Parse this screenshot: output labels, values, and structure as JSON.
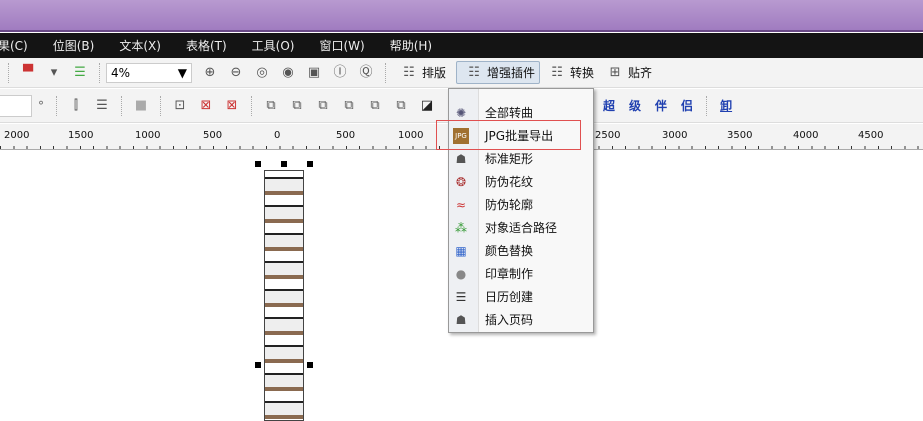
{
  "menubar": [
    "果(C)",
    "位图(B)",
    "文本(X)",
    "表格(T)",
    "工具(O)",
    "窗口(W)",
    "帮助(H)"
  ],
  "toolbar1": {
    "zoom_value": "4%",
    "buttons": [
      {
        "label": "排版",
        "icon": "layout-icon"
      },
      {
        "label": "增强插件",
        "icon": "plugin-icon",
        "active": true
      },
      {
        "label": "转换",
        "icon": "convert-icon"
      },
      {
        "label": "贴齐",
        "icon": "snap-icon"
      }
    ]
  },
  "toolbar2": {
    "degree_symbol": "°",
    "plugin_links": [
      "超",
      "级",
      "伴",
      "侣",
      "卸"
    ]
  },
  "ruler": [
    "2000",
    "1500",
    "1000",
    "500",
    "0",
    "500",
    "1000",
    "2500",
    "3000",
    "3500",
    "4000",
    "4500"
  ],
  "dropdown": {
    "items": [
      {
        "label": "全部转曲",
        "icon": "curve-icon"
      },
      {
        "label": "JPG批量导出",
        "icon": "jpg-icon",
        "highlighted": true
      },
      {
        "label": "标准矩形",
        "icon": "rect-icon"
      },
      {
        "label": "防伪花纹",
        "icon": "pattern-icon"
      },
      {
        "label": "防伪轮廓",
        "icon": "wave-icon"
      },
      {
        "label": "对象适合路径",
        "icon": "path-icon"
      },
      {
        "label": "颜色替换",
        "icon": "color-icon"
      },
      {
        "label": "印章制作",
        "icon": "stamp-icon"
      },
      {
        "label": "日历创建",
        "icon": "calendar-icon"
      },
      {
        "label": "插入页码",
        "icon": "page-number-icon"
      }
    ]
  },
  "colors": {
    "menubar": "#141414",
    "highlight_border": "#e05050",
    "accent_links": "#2040b0"
  }
}
